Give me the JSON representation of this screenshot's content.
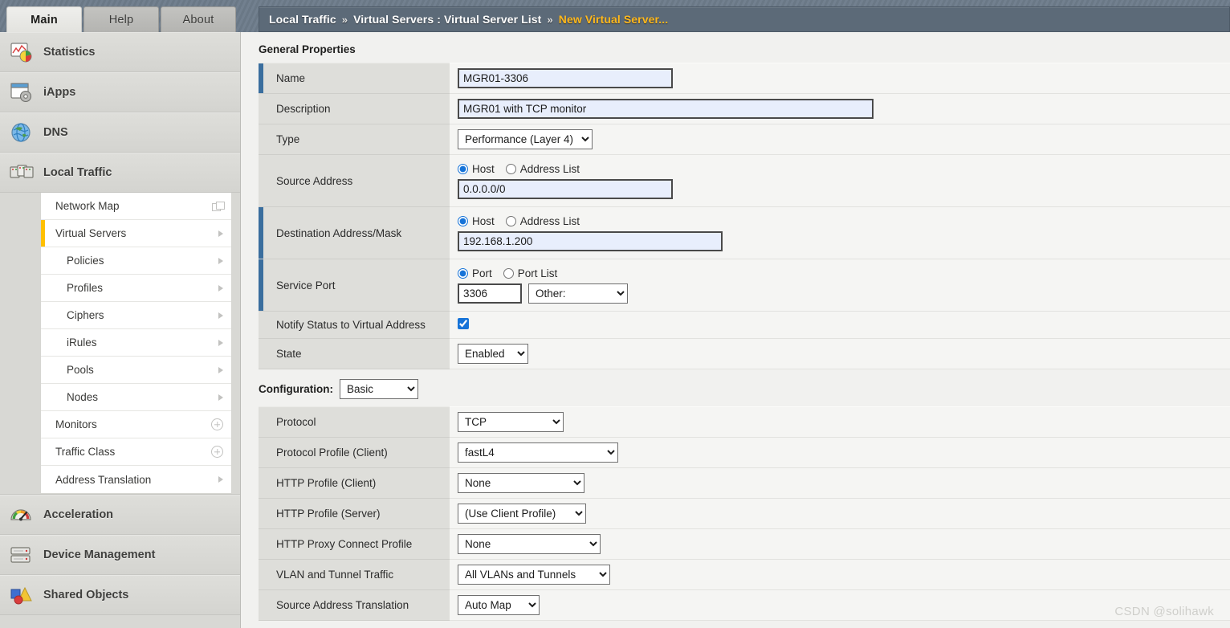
{
  "tabs": [
    {
      "label": "Main",
      "active": true
    },
    {
      "label": "Help",
      "active": false
    },
    {
      "label": "About",
      "active": false
    }
  ],
  "breadcrumb": {
    "sep": "»",
    "items": [
      "Local Traffic",
      "Virtual Servers : Virtual Server List",
      "New Virtual Server..."
    ]
  },
  "sidebar": {
    "sections_top": [
      {
        "label": "Statistics",
        "icon": "statistics-chart-icon"
      },
      {
        "label": "iApps",
        "icon": "iapps-window-gear-icon"
      },
      {
        "label": "DNS",
        "icon": "dns-globe-icon"
      },
      {
        "label": "Local Traffic",
        "icon": "local-traffic-servers-icon"
      }
    ],
    "submenu": [
      {
        "label": "Network Map",
        "icon": "popout-window-icon",
        "indent": false,
        "active": false
      },
      {
        "label": "Virtual Servers",
        "icon": "arrow-right-icon",
        "indent": false,
        "active": true
      },
      {
        "label": "Policies",
        "icon": "arrow-right-icon",
        "indent": true,
        "active": false
      },
      {
        "label": "Profiles",
        "icon": "arrow-right-icon",
        "indent": true,
        "active": false
      },
      {
        "label": "Ciphers",
        "icon": "arrow-right-icon",
        "indent": true,
        "active": false
      },
      {
        "label": "iRules",
        "icon": "arrow-right-icon",
        "indent": true,
        "active": false
      },
      {
        "label": "Pools",
        "icon": "arrow-right-icon",
        "indent": true,
        "active": false
      },
      {
        "label": "Nodes",
        "icon": "arrow-right-icon",
        "indent": true,
        "active": false
      },
      {
        "label": "Monitors",
        "icon": "plus-circle-icon",
        "indent": false,
        "active": false
      },
      {
        "label": "Traffic Class",
        "icon": "plus-circle-icon",
        "indent": false,
        "active": false
      },
      {
        "label": "Address Translation",
        "icon": "arrow-right-icon",
        "indent": false,
        "active": false
      }
    ],
    "sections_bottom": [
      {
        "label": "Acceleration",
        "icon": "acceleration-gauge-icon"
      },
      {
        "label": "Device Management",
        "icon": "device-rack-icon"
      },
      {
        "label": "Shared Objects",
        "icon": "shared-objects-shapes-icon"
      }
    ]
  },
  "general_properties": {
    "heading": "General Properties",
    "name": {
      "label": "Name",
      "value": "MGR01-3306"
    },
    "description": {
      "label": "Description",
      "value": "MGR01 with TCP monitor"
    },
    "type": {
      "label": "Type",
      "value": "Performance (Layer 4)"
    },
    "source_address": {
      "label": "Source Address",
      "radio_host": "Host",
      "radio_list": "Address List",
      "selected": "Host",
      "value": "0.0.0.0/0"
    },
    "destination": {
      "label": "Destination Address/Mask",
      "radio_host": "Host",
      "radio_list": "Address List",
      "selected": "Host",
      "value": "192.168.1.200"
    },
    "service_port": {
      "label": "Service Port",
      "radio_port": "Port",
      "radio_list": "Port List",
      "selected": "Port",
      "value": "3306",
      "other_select": "Other:"
    },
    "notify": {
      "label": "Notify Status to Virtual Address",
      "checked": true
    },
    "state": {
      "label": "State",
      "value": "Enabled"
    }
  },
  "configuration": {
    "heading": "Configuration:",
    "mode": "Basic",
    "rows": [
      {
        "label": "Protocol",
        "value": "TCP"
      },
      {
        "label": "Protocol Profile (Client)",
        "value": "fastL4"
      },
      {
        "label": "HTTP Profile (Client)",
        "value": "None"
      },
      {
        "label": "HTTP Profile (Server)",
        "value": "(Use Client Profile)"
      },
      {
        "label": "HTTP Proxy Connect Profile",
        "value": "None"
      },
      {
        "label": "VLAN and Tunnel Traffic",
        "value": "All VLANs and Tunnels"
      },
      {
        "label": "Source Address Translation",
        "value": "Auto Map"
      }
    ]
  },
  "watermark": "CSDN @solihawk",
  "colors": {
    "accent_required": "#3a6e9e",
    "active_indicator": "#ffc000",
    "breadcrumb_bg": "#5c6a78",
    "breadcrumb_last": "#ffb81c",
    "input_bg": "#e8eefc",
    "control_blue": "#1673d8"
  }
}
